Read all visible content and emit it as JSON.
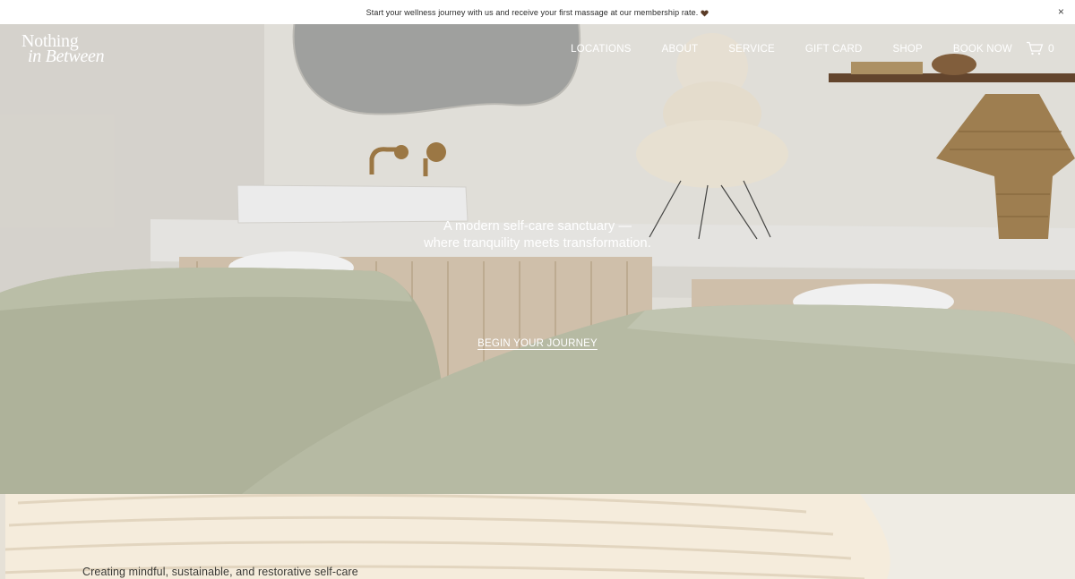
{
  "announcement": {
    "text": "Start your wellness journey with us and receive your first massage at our membership rate.",
    "close_symbol": "×"
  },
  "logo": {
    "line1": "Nothing",
    "line2": "in Between"
  },
  "nav": {
    "items": [
      {
        "label": "LOCATIONS"
      },
      {
        "label": "ABOUT"
      },
      {
        "label": "SERVICE"
      },
      {
        "label": "GIFT CARD"
      },
      {
        "label": "SHOP"
      },
      {
        "label": "BOOK NOW"
      }
    ],
    "cart_count": "0",
    "cart_icon": "cart-icon"
  },
  "hero": {
    "tagline_line1": "A modern self-care sanctuary —",
    "tagline_line2": "where tranquility meets transformation.",
    "cta_label": "BEGIN YOUR JOURNEY"
  },
  "lower": {
    "intro_text": "Creating mindful, sustainable, and restorative self-care"
  },
  "colors": {
    "heart": "#5a3b26",
    "blanket": "#b7bda3",
    "wall": "#eceae4"
  }
}
